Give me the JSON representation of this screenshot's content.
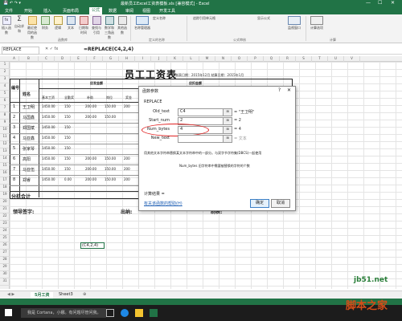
{
  "titlebar": {
    "title": "最新员工Excel工资表模板.xls [兼容模式] - Excel",
    "quick": "💾 ↶ ↷ ▾",
    "min": "—",
    "max": "☐",
    "close": "✕"
  },
  "tabs": [
    "文件",
    "开始",
    "插入",
    "页面布局",
    "公式",
    "数据",
    "审阅",
    "视图",
    "开发工具"
  ],
  "active_tab": "公式",
  "ribbon": {
    "buttons": [
      "插入函数",
      "自动求和",
      "最近使用的函数",
      "财务",
      "逻辑",
      "文本",
      "日期和时间",
      "查找与引用",
      "数学和三角函数",
      "其他函数",
      "名称管理器",
      "定义名称",
      "追踪引用单元格",
      "显示公式",
      "监视窗口",
      "计算选项"
    ],
    "groups": [
      "函数库",
      "定义的名称",
      "公式审核",
      "计算"
    ]
  },
  "formula_bar": {
    "name_box": "REPLACE",
    "fx": "✕ ✓ fx",
    "formula": "=REPLACE(C4,2,4)"
  },
  "columns": [
    "A",
    "B",
    "C",
    "D",
    "E",
    "F",
    "G",
    "H",
    "I",
    "J",
    "K",
    "L",
    "M",
    "N",
    "O",
    "P",
    "Q",
    "R",
    "S",
    "T",
    "U",
    "V"
  ],
  "rows": [
    "1",
    "2",
    "3",
    "4",
    "5",
    "6",
    "7",
    "8",
    "9",
    "10",
    "11",
    "12",
    "13",
    "14",
    "15",
    "16",
    "17",
    "18",
    "19",
    "20",
    "21",
    "22",
    "23",
    "24",
    "25",
    "26",
    "27",
    "28",
    "29",
    "30",
    "31"
  ],
  "sheet": {
    "title": "员工工资表",
    "date_line": "制表日期：2015年12月  结算日期：2015年1月",
    "header_num": "编号",
    "header_name": "姓名",
    "header_group1": "应发金额",
    "header_group2": "应扣金额",
    "sub_headers": [
      "基本工资",
      "全勤奖",
      "补助",
      "岗位",
      "奖金"
    ],
    "employees": [
      "王卫明",
      "马国鑫",
      "郑国斌",
      "马亚鑫",
      "张家琴",
      "高阳",
      "马亚伍",
      "郑睿"
    ],
    "values": [
      [
        "1450.00",
        "150",
        "200.00",
        "150.00",
        "200"
      ],
      [
        "1450.00",
        "150",
        "200.00",
        "150.00",
        ""
      ],
      [
        "1450.00",
        "150",
        "",
        "",
        ""
      ],
      [
        "1450.00",
        "150",
        "",
        "",
        ""
      ],
      [
        "1450.00",
        "150",
        "",
        "",
        ""
      ],
      [
        "1450.00",
        "150",
        "200.00",
        "150.00",
        "200"
      ],
      [
        "1450.00",
        "150",
        "200.00",
        "150.00",
        "200"
      ],
      [
        "1450.00",
        "0.00",
        "200.00",
        "150.00",
        "200"
      ]
    ],
    "total_label": "分栏合计",
    "sign1": "领导签字:",
    "sign2": "出纳:",
    "sign3": "制表:",
    "active_cell": "(C4,2,4)"
  },
  "dialog": {
    "title": "函数参数",
    "help": "?",
    "close": "✕",
    "func": "REPLACE",
    "args": [
      {
        "label": "Old_text",
        "value": "C4",
        "result": "= \"王卫明\""
      },
      {
        "label": "Start_num",
        "value": "2",
        "result": "= 2"
      },
      {
        "label": "Num_bytes",
        "value": "4",
        "result": "= 4"
      },
      {
        "label": "New_text",
        "value": "",
        "result": "= 文本"
      }
    ],
    "desc1": "用其他文本字符串替换某文本字符串中的一部分。与双字节字符集(DBCS)一起使用",
    "desc2": "Num_bytes  旧字符串中需要被替换的字符的个数",
    "calc_result": "计算结果 =",
    "help_link": "有关该函数的帮助(H)",
    "ok": "确定",
    "cancel": "取消"
  },
  "sheet_tabs": [
    "5月工资",
    "Sheet3"
  ],
  "add_sheet": "⊕",
  "taskbar": {
    "search": "我是 Cortana，小娜。有问题尽管问我。"
  },
  "watermark": {
    "line1": "jb51.net",
    "line2": "脚本之家"
  }
}
